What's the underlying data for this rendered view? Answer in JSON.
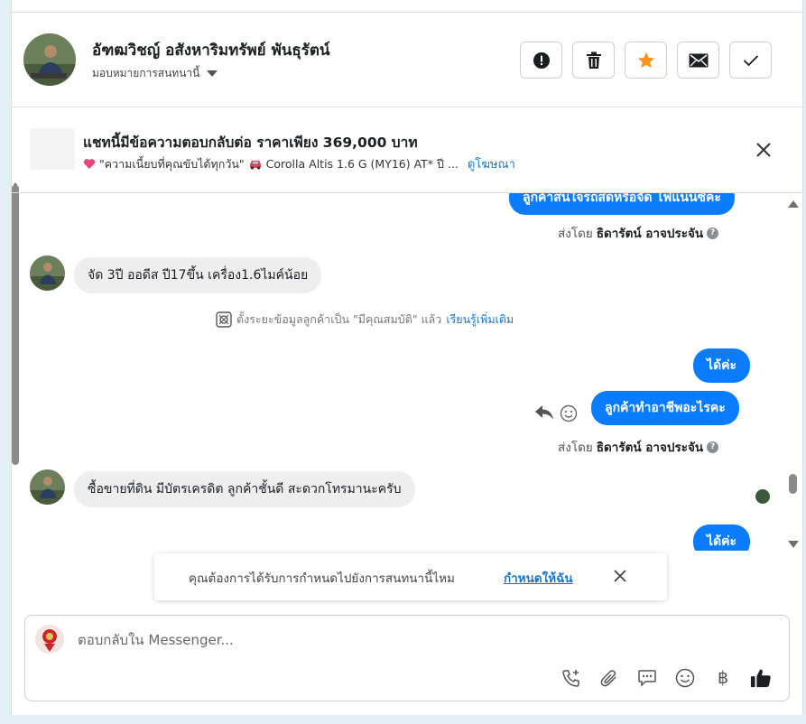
{
  "header": {
    "contact_name": "อัฑฒวิชญ์ อสังหาริมทรัพย์ พันธุรัตน์",
    "assign_label": "มอบหมายการสนทนานี้",
    "buttons": [
      {
        "name": "report-button",
        "icon": "alert-icon"
      },
      {
        "name": "delete-button",
        "icon": "trash-icon"
      },
      {
        "name": "star-button",
        "icon": "star-icon"
      },
      {
        "name": "mark-unread-button",
        "icon": "mail-icon"
      },
      {
        "name": "done-button",
        "icon": "check-icon"
      }
    ],
    "star_color": "#f7931e"
  },
  "listing": {
    "title": "แชทนี้มีข้อความตอบกลับต่อ ราคาเพียง 369,000 บาท",
    "tagline": "\"ความเนี้ยบที่คุณขับได้ทุกวัน\"",
    "model": "Corolla Altis 1.6 G (MY16) AT* ปี ...",
    "view_ad": "ดูโฆษณา"
  },
  "messages": {
    "out_top": "ลูกค้าสนใจรถสดหรือจัด ไฟแนนซ์คะ",
    "sent_by_prefix": "ส่งโดย",
    "sent_by_name": "ธิดารัตน์ อาจประจัน",
    "in_1": "จัด 3ปี  ออดีส ปี17ขึ้น  เครื่อง1.6ไมค์น้อย",
    "system_text": "ตั้งระยะข้อมูลลูกค้าเป็น \"มีคุณสมบัติ\" แล้ว",
    "system_link": "เรียนรู้เพิ่มเติม",
    "out_2": "ได้ค่ะ",
    "out_3": "ลูกค้าทำอาชีพอะไรคะ",
    "in_2": "ซื้อขายที่ดิน มีบัตรเครดิต ลูกค้าชั้นดี สะดวกโทรมานะครับ",
    "out_4": "ได้ค่ะ"
  },
  "toast": {
    "text": "คุณต้องการได้รับการกำหนดไปยังการสนทนานี้ไหม",
    "link": "กำหนดให้ฉัน"
  },
  "composer": {
    "placeholder": "ตอบกลับใน Messenger...",
    "tools": [
      "add-call-icon",
      "attachment-icon",
      "saved-reply-icon",
      "emoji-icon",
      "baht-icon",
      "like-icon"
    ],
    "baht_symbol": "฿"
  },
  "colors": {
    "outgoing_bubble": "#0a7cff",
    "incoming_bubble": "#eeeeee",
    "link": "#1877c8"
  }
}
